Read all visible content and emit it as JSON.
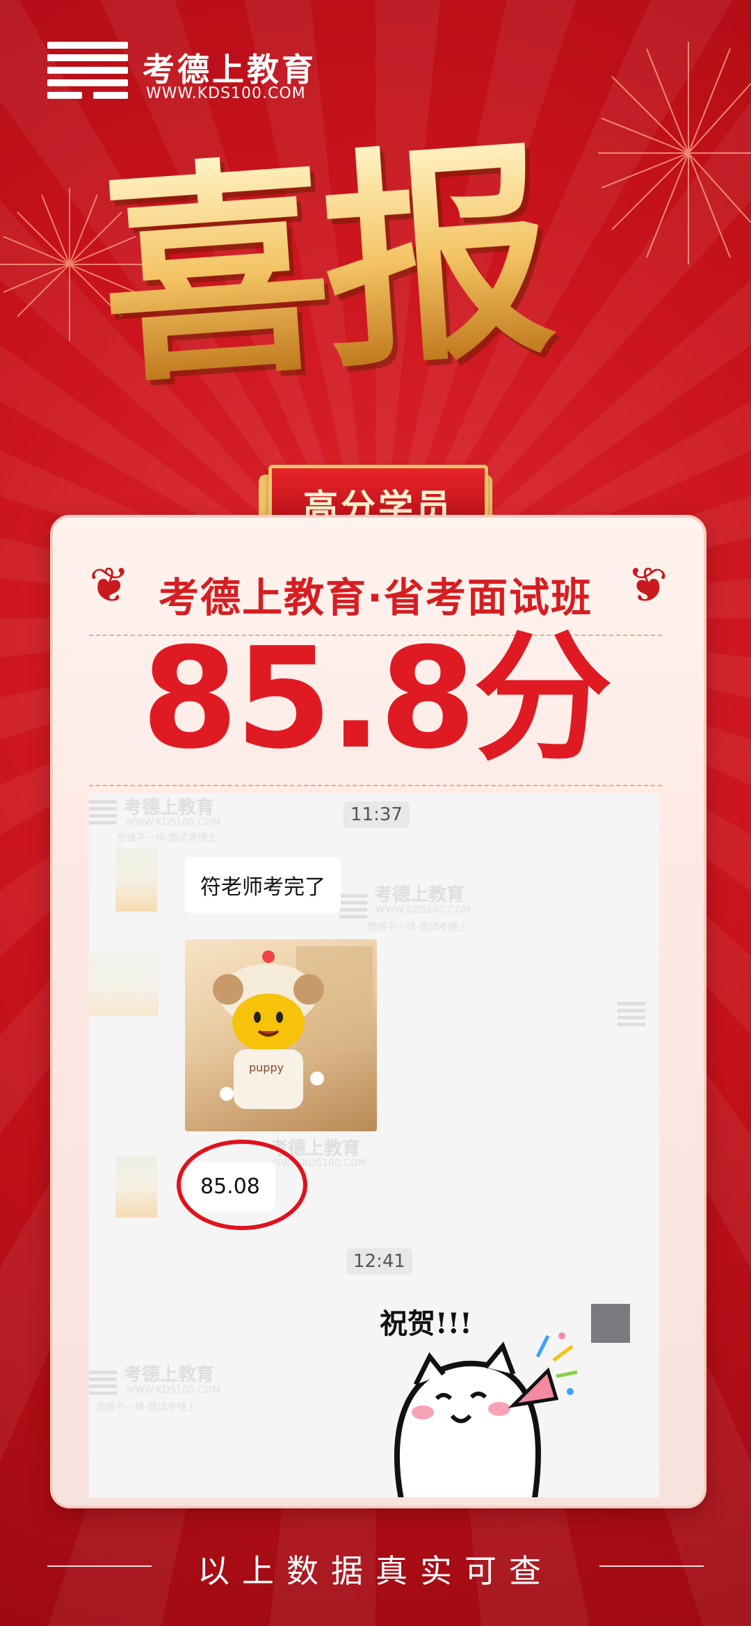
{
  "brand": {
    "name": "考德上教育",
    "url": "WWW.KDS100.COM"
  },
  "headline": "喜报",
  "ribbon_label": "高分学员",
  "subtitle": "考德上教育·省考面试班",
  "score": "85.8分",
  "chat": {
    "time_1": "11:37",
    "message_1": "符老师考完了",
    "message_score": "85.08",
    "time_2": "12:41",
    "sticker_text": "祝贺!!!",
    "puppy_label": "puppy",
    "watermark": {
      "brand": "考德上教育",
      "url": "WWW.KDS100.COM",
      "slogan": "思维不一样·面试考德上"
    }
  },
  "footer": "以上数据真实可查",
  "colors": {
    "background": "#c8121c",
    "accent_red": "#e01a22",
    "gold": "#f3c363",
    "card": "#fff3ee"
  }
}
